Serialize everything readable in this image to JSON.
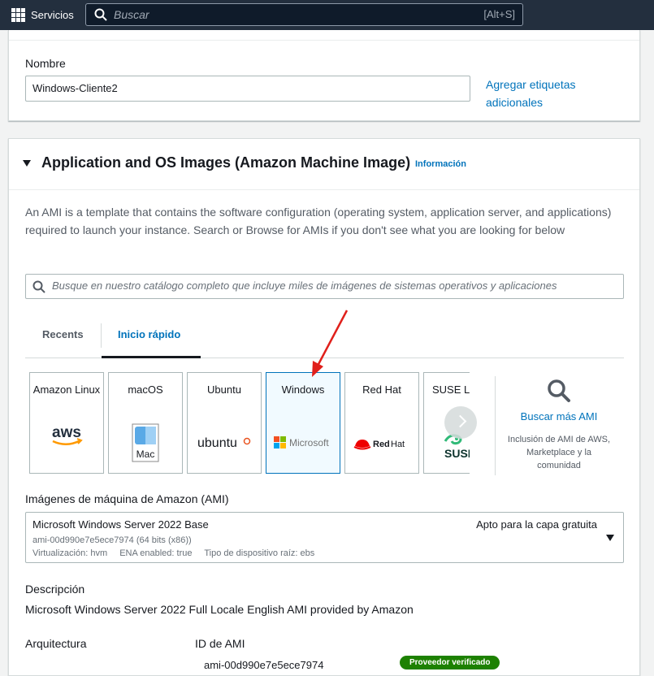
{
  "topbar": {
    "services_label": "Servicios",
    "search_placeholder": "Buscar",
    "shortcut": "[Alt+S]"
  },
  "name_section": {
    "label": "Nombre",
    "value": "Windows-Cliente2",
    "tags_link": "Agregar etiquetas adicionales"
  },
  "ami_section": {
    "title": "Application and OS Images (Amazon Machine Image)",
    "info_link": "Información",
    "description": "An AMI is a template that contains the software configuration (operating system, application server, and applications) required to launch your instance. Search or Browse for AMIs if you don't see what you are looking for below",
    "search_placeholder": "Busque en nuestro catálogo completo que incluye miles de imágenes de sistemas operativos y aplicaciones",
    "tabs": [
      "Recents",
      "Inicio rápido"
    ],
    "active_tab": "Inicio rápido",
    "os_cards": [
      {
        "name": "Amazon Linux",
        "logo": "aws",
        "selected": false
      },
      {
        "name": "macOS",
        "logo": "Mac",
        "selected": false
      },
      {
        "name": "Ubuntu",
        "logo": "ubuntu",
        "selected": false
      },
      {
        "name": "Windows",
        "logo": "Microsoft",
        "selected": true
      },
      {
        "name": "Red Hat",
        "logo": "Red Hat",
        "selected": false
      },
      {
        "name": "SUSE Linux",
        "logo": "SUSE",
        "selected": false
      }
    ],
    "more_link": "Buscar más AMI",
    "more_desc": "Inclusión de AMI de AWS, Marketplace y la comunidad",
    "ami_label": "Imágenes de máquina de Amazon (AMI)",
    "selected_ami": {
      "name": "Microsoft Windows Server 2022 Base",
      "id_line": "ami-00d990e7e5ece7974 (64 bits (x86))",
      "virt": "Virtualización: hvm",
      "ena": "ENA enabled: true",
      "root": "Tipo de dispositivo raíz: ebs",
      "tier": "Apto para la capa gratuita"
    },
    "description_label": "Descripción",
    "description_value": "Microsoft Windows Server 2022 Full Locale English AMI provided by Amazon",
    "arch_label": "Arquitectura",
    "ami_id_label": "ID de AMI",
    "ami_id_value": "ami-00d990e7e5ece7974",
    "verified_badge": "Proveedor verificado"
  },
  "colors": {
    "accent": "#0073bb",
    "topbar": "#232f3e",
    "annotation_arrow": "#e0201b"
  }
}
